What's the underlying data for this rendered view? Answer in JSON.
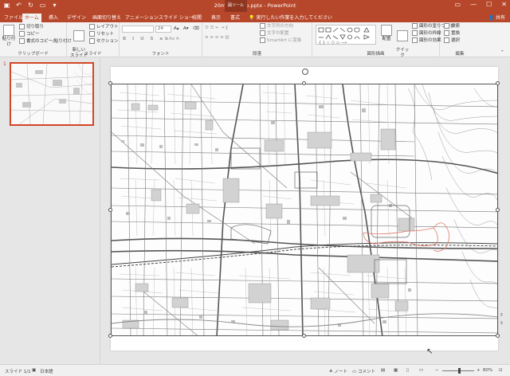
{
  "window": {
    "title": "20m888-map.pptx - PowerPoint",
    "context_tab_group": "図ツール",
    "controls": [
      "—",
      "☐",
      "✕"
    ]
  },
  "tabs": [
    {
      "label": "ファイル",
      "active": false
    },
    {
      "label": "ホーム",
      "active": true
    },
    {
      "label": "挿入",
      "active": false
    },
    {
      "label": "デザイン",
      "active": false
    },
    {
      "label": "画面切り替え",
      "active": false
    },
    {
      "label": "アニメーション",
      "active": false
    },
    {
      "label": "スライド ショー",
      "active": false
    },
    {
      "label": "校閲",
      "active": false
    },
    {
      "label": "表示",
      "active": false
    },
    {
      "label": "書式",
      "active": false
    }
  ],
  "tell_me": "実行したい作業を入力してください",
  "share": "共有",
  "ribbon": {
    "clipboard": {
      "paste": "貼り付け",
      "cut": "切り取り",
      "copy": "コピー",
      "format_painter": "書式のコピー/貼り付け",
      "label": "クリップボード"
    },
    "slides": {
      "new_slide": "新しい\nスライド",
      "layout": "レイアウト",
      "reset": "リセット",
      "section": "セクション",
      "label": "スライド"
    },
    "font": {
      "font_size": "24",
      "label": "フォント"
    },
    "paragraph": {
      "text_direction": "文字列の方向",
      "align_text": "文字の配置",
      "smartart": "SmartArt に変換",
      "label": "段落"
    },
    "drawing": {
      "arrange": "配置",
      "quick_styles": "クイック\nスタイル",
      "shape_fill": "図形の塗りつぶし",
      "shape_outline": "図形の枠線",
      "shape_effects": "図形の効果",
      "label": "図形描画"
    },
    "editing": {
      "find": "検索",
      "replace": "置換",
      "select": "選択",
      "label": "編集"
    }
  },
  "slides_pane": {
    "slide_number": "1"
  },
  "status": {
    "slide_indicator": "スライド 1/1",
    "language": "日本語",
    "notes": "ノート",
    "comments": "コメント",
    "zoom": "80%"
  },
  "colors": {
    "accent": "#b7472a",
    "selection": "#d24726",
    "map_lines": "#6e6e6e",
    "highlight": "#e07a6a"
  }
}
